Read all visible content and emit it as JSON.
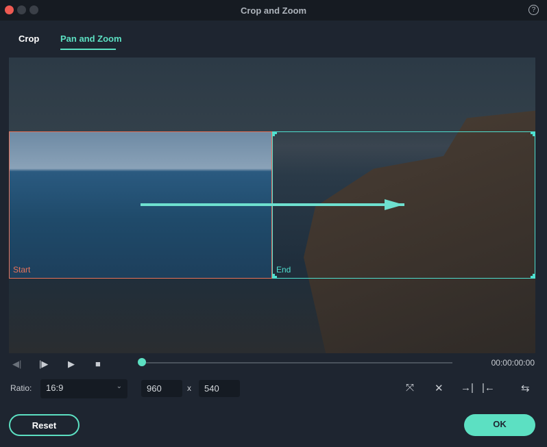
{
  "window": {
    "title": "Crop and Zoom",
    "help_icon": "question-circle-icon"
  },
  "tabs": [
    {
      "label": "Crop",
      "active": false
    },
    {
      "label": "Pan and Zoom",
      "active": true
    }
  ],
  "preview": {
    "start_label": "Start",
    "end_label": "End",
    "start_color": "#e8735a",
    "end_color": "#4fe0d0"
  },
  "playback": {
    "time": "00:00:00:00",
    "progress": 0
  },
  "ratio": {
    "label": "Ratio:",
    "value": "16:9"
  },
  "size": {
    "width": "960",
    "separator": "x",
    "height": "540"
  },
  "buttons": {
    "reset": "Reset",
    "ok": "OK"
  },
  "colors": {
    "accent": "#5ce0c2",
    "background": "#1e2530"
  }
}
